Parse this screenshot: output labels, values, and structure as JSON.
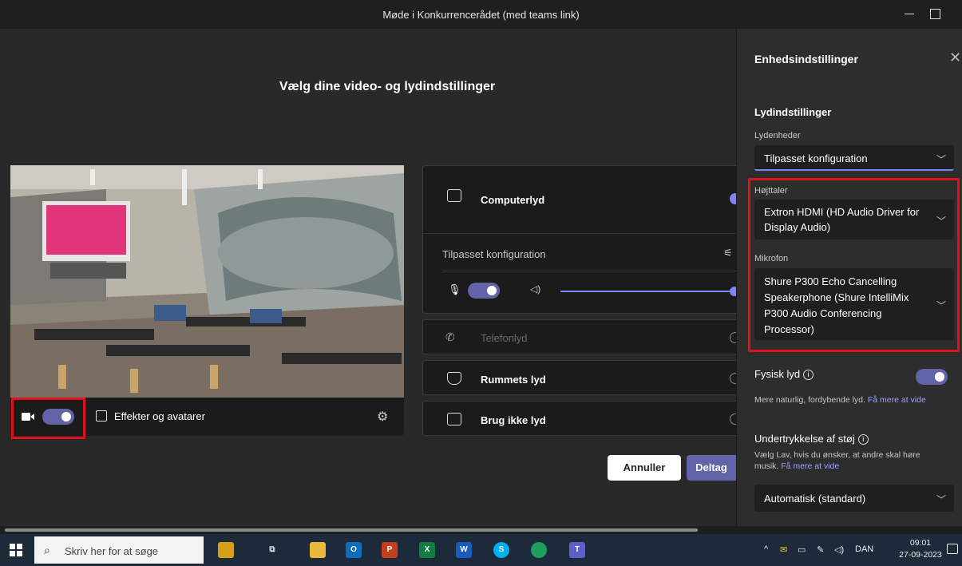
{
  "window": {
    "title": "Møde i Konkurrencerådet (med teams link)"
  },
  "main": {
    "heading": "Vælg dine video- og lydindstillinger",
    "video": {
      "camera_on": true,
      "effects_label": "Effekter og avatarer"
    },
    "audio_options": {
      "computer_audio": "Computerlyd",
      "custom_config": "Tilpasset konfiguration",
      "phone_audio": "Telefonlyd",
      "room_audio": "Rummets lyd",
      "no_audio": "Brug ikke lyd",
      "selected": "Computerlyd",
      "mic_on": true,
      "speaker_volume": 1.0
    },
    "buttons": {
      "cancel": "Annuller",
      "join": "Deltag"
    }
  },
  "side_panel": {
    "title": "Enhedsindstillinger",
    "audio_settings_heading": "Lydindstillinger",
    "audio_devices_label": "Lydenheder",
    "audio_devices_value": "Tilpasset konfiguration",
    "speaker_label": "Højttaler",
    "speaker_line1": "Extron HDMI (HD Audio Driver for",
    "speaker_line2": "Display Audio)",
    "mic_label": "Mikrofon",
    "mic_line1": "Shure P300 Echo Cancelling",
    "mic_line2": "Speakerphone (Shure IntelliMix",
    "mic_line3": "P300 Audio Conferencing",
    "mic_line4": "Processor)",
    "spatial_audio_label": "Fysisk lyd",
    "spatial_audio_on": true,
    "spatial_audio_note": "Mere naturlig, fordybende lyd.",
    "learn_more": "Få mere at vide",
    "noise_label": "Undertrykkelse af støj",
    "noise_note_line1": "Vælg Lav, hvis du ønsker, at andre skal høre",
    "noise_note_line2": "musik.",
    "noise_value": "Automatisk (standard)"
  },
  "taskbar": {
    "search_placeholder": "Skriv her for at søge",
    "language": "DAN",
    "time": "09:01",
    "date": "27-09-2023"
  },
  "colors": {
    "accent": "#6264a7",
    "accent_light": "#7f85f5",
    "highlight_red": "#e0101a"
  }
}
